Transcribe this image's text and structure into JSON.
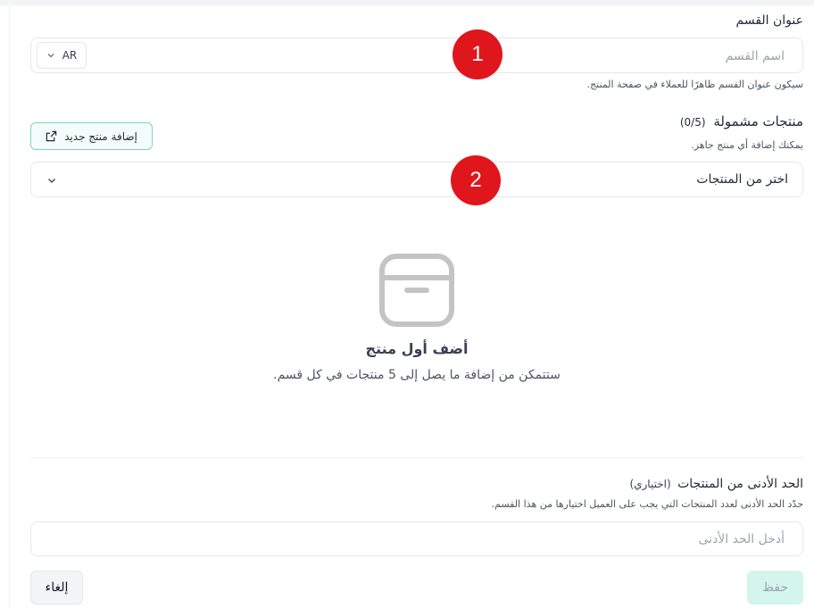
{
  "section_title": {
    "label": "عنوان القسم",
    "placeholder": "اسم القسم",
    "language": "AR",
    "hint": "سيكون عنوان القسم ظاهرًا للعملاء في صفحة المنتج."
  },
  "markers": [
    "1",
    "2"
  ],
  "products": {
    "label": "منتجات مشمولة",
    "count": "(0/5)",
    "hint": "يمكنك إضافة أي منتج جاهز.",
    "add_button": "إضافة منتج جديد",
    "select_placeholder": "اختر من المنتجات"
  },
  "empty_state": {
    "title": "أضف أول منتج",
    "description": "ستتمكن من إضافة ما يصل إلى 5 منتجات في كل قسم."
  },
  "min_products": {
    "label": "الحد الأدنى من المنتجات",
    "optional": "(اختياري)",
    "hint": "حدّد الحد الأدنى لعدد المنتجات التي يجب على العميل اختيارها من هذا القسم.",
    "placeholder": "أدخل الحد الأدنى"
  },
  "actions": {
    "cancel": "إلغاء",
    "save": "حفظ"
  },
  "colors": {
    "marker": "#e0161d",
    "accent_border": "#7dd3c3",
    "save_bg": "#d4f5ee"
  },
  "icons": {
    "external_link": "external-link-icon",
    "chevron": "chevron-down-icon",
    "box": "box-icon"
  }
}
